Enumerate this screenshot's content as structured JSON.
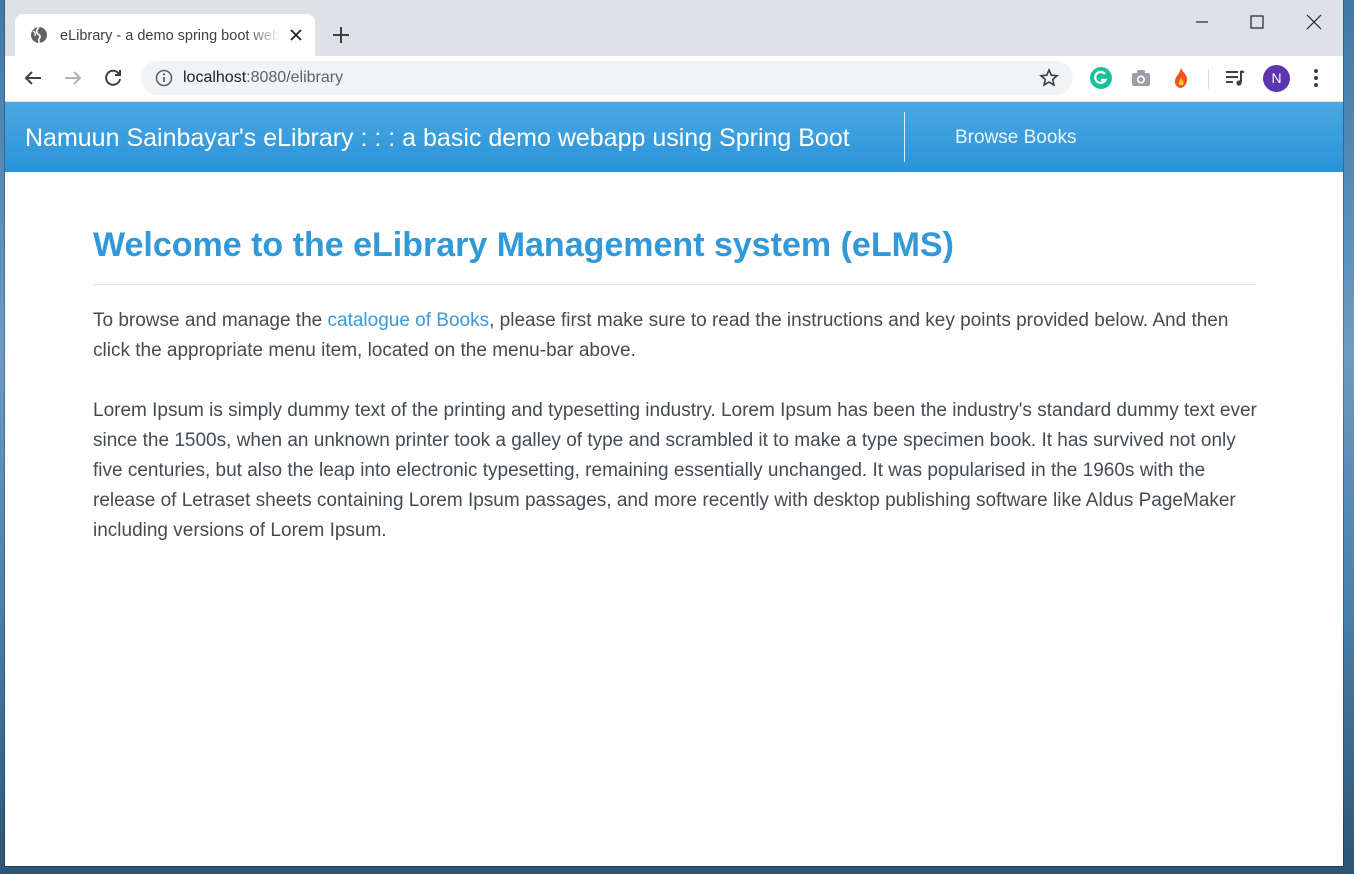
{
  "browser": {
    "tab": {
      "title": "eLibrary - a demo spring boot webapp",
      "favicon_icon": "globe-icon"
    },
    "url_host": "localhost",
    "url_path": ":8080/elibrary",
    "avatar_initial": "N",
    "extensions": [
      "grammarly-icon",
      "camera-icon",
      "flame-icon",
      "media-queue-icon"
    ]
  },
  "navbar": {
    "brand": "Namuun Sainbayar's eLibrary : : : a basic demo webapp using Spring Boot",
    "links": [
      {
        "label": "Browse Books"
      }
    ]
  },
  "main": {
    "heading": "Welcome to the eLibrary Management system (eLMS)",
    "intro_before": "To browse and manage the ",
    "intro_link": "catalogue of Books",
    "intro_after": ", please first make sure to read the instructions and key points provided below. And then click the appropriate menu item, located on the menu-bar above.",
    "lorem": "Lorem Ipsum is simply dummy text of the printing and typesetting industry. Lorem Ipsum has been the industry's standard dummy text ever since the 1500s, when an unknown printer took a galley of type and scrambled it to make a type specimen book. It has survived not only five centuries, but also the leap into electronic typesetting, remaining essentially unchanged. It was popularised in the 1960s with the release of Letraset sheets containing Lorem Ipsum passages, and more recently with desktop publishing software like Aldus PageMaker including versions of Lorem Ipsum."
  },
  "colors": {
    "navbar": "#2a93d8",
    "heading": "#3299d9",
    "link": "#3a9ad9",
    "text": "#444b52"
  }
}
